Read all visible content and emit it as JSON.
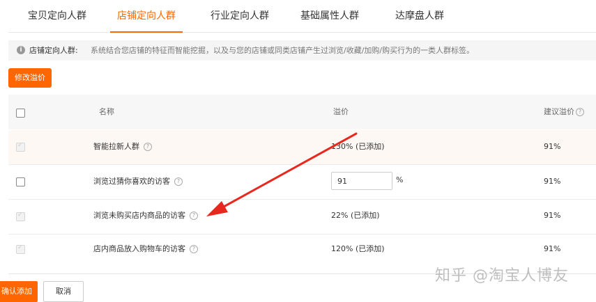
{
  "tabs": [
    "宝贝定向人群",
    "店铺定向人群",
    "行业定向人群",
    "基础属性人群",
    "达摩盘人群"
  ],
  "info": {
    "icon": "info-icon",
    "label": "店铺定向人群:",
    "text": "系统结合您店铺的特征而智能挖掘，以及与您的店铺或同类店铺产生过浏览/收藏/加购/购买行为的一类人群标签。"
  },
  "edit_button": "修改溢价",
  "table": {
    "headers": {
      "name": "名称",
      "premium": "溢价",
      "suggested": "建议溢价"
    },
    "rows": [
      {
        "name": "智能拉新人群",
        "premium": "130% (已添加)",
        "suggested": "91%"
      },
      {
        "name": "浏览过猜你喜欢的访客",
        "premium_input": "91",
        "premium_unit": "%",
        "suggested": "91%"
      },
      {
        "name": "浏览未购买店内商品的访客",
        "premium": "22% (已添加)",
        "suggested": "91%"
      },
      {
        "name": "店内商品放入购物车的访客",
        "premium": "120% (已添加)",
        "suggested": "91%"
      }
    ]
  },
  "footer": {
    "confirm": "确认添加",
    "cancel": "取消"
  },
  "watermark": "知乎 @淘宝人博友",
  "colors": {
    "accent": "#ff6600",
    "annotation_arrow": "#e8281e"
  }
}
